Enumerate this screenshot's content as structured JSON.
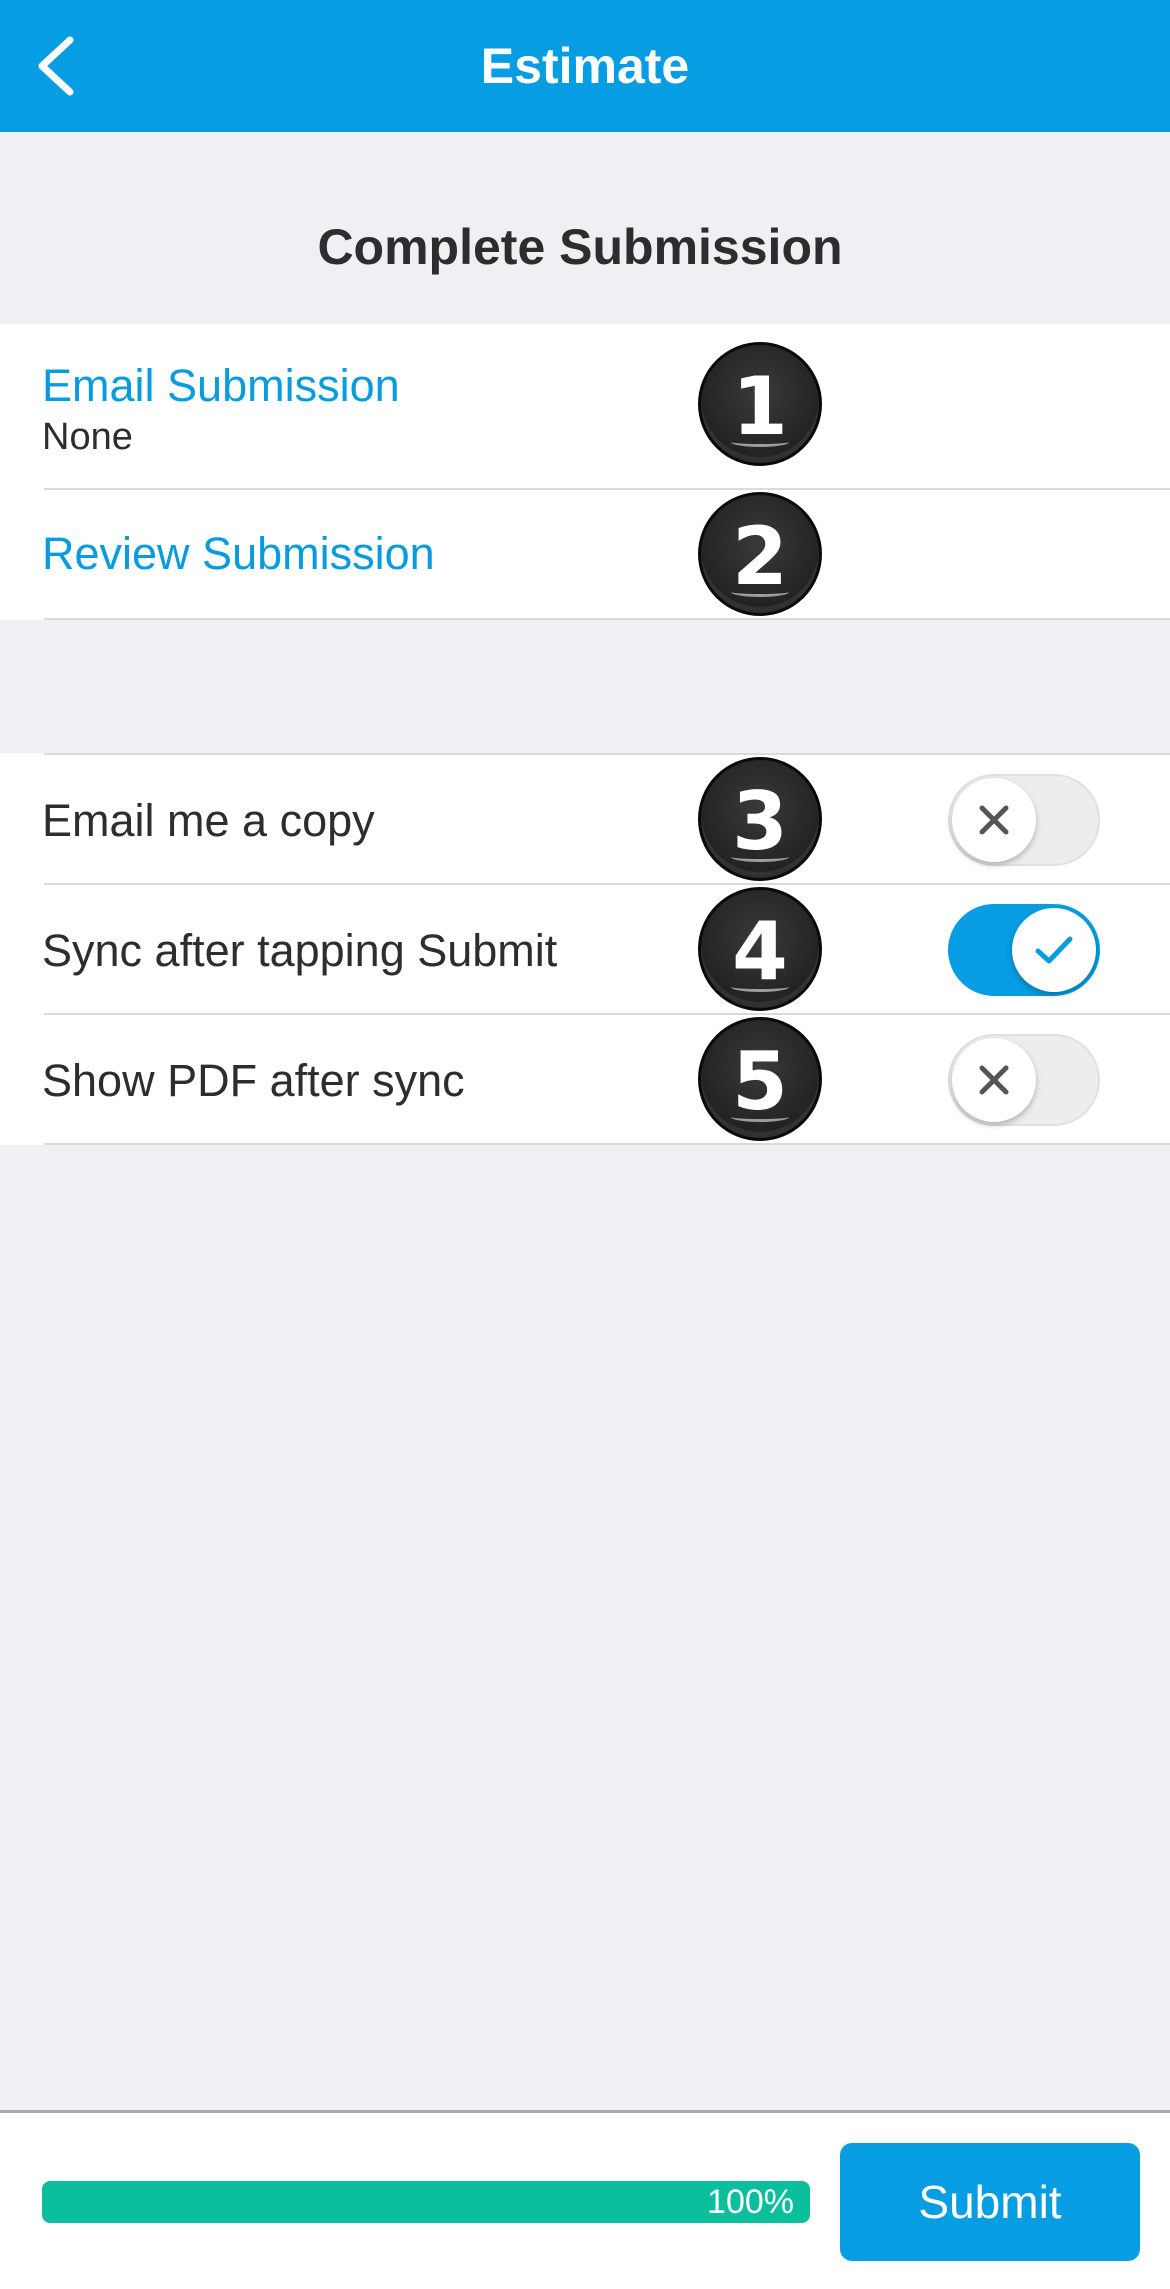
{
  "header": {
    "title": "Estimate",
    "back_icon": "chevron-left-icon"
  },
  "section_title": "Complete Submission",
  "links": {
    "email_submission": {
      "label": "Email Submission",
      "value": "None"
    },
    "review_submission": {
      "label": "Review Submission"
    }
  },
  "settings": [
    {
      "label": "Email me a copy",
      "enabled": false
    },
    {
      "label": "Sync after tapping Submit",
      "enabled": true
    },
    {
      "label": "Show PDF after sync",
      "enabled": false
    }
  ],
  "badges": [
    "1",
    "2",
    "3",
    "4",
    "5"
  ],
  "footer": {
    "progress_percent": 100,
    "progress_label": "100%",
    "submit_label": "Submit"
  },
  "colors": {
    "accent": "#069de3",
    "link": "#079bdf",
    "progress": "#0bbf9c",
    "background": "#efeff4"
  }
}
